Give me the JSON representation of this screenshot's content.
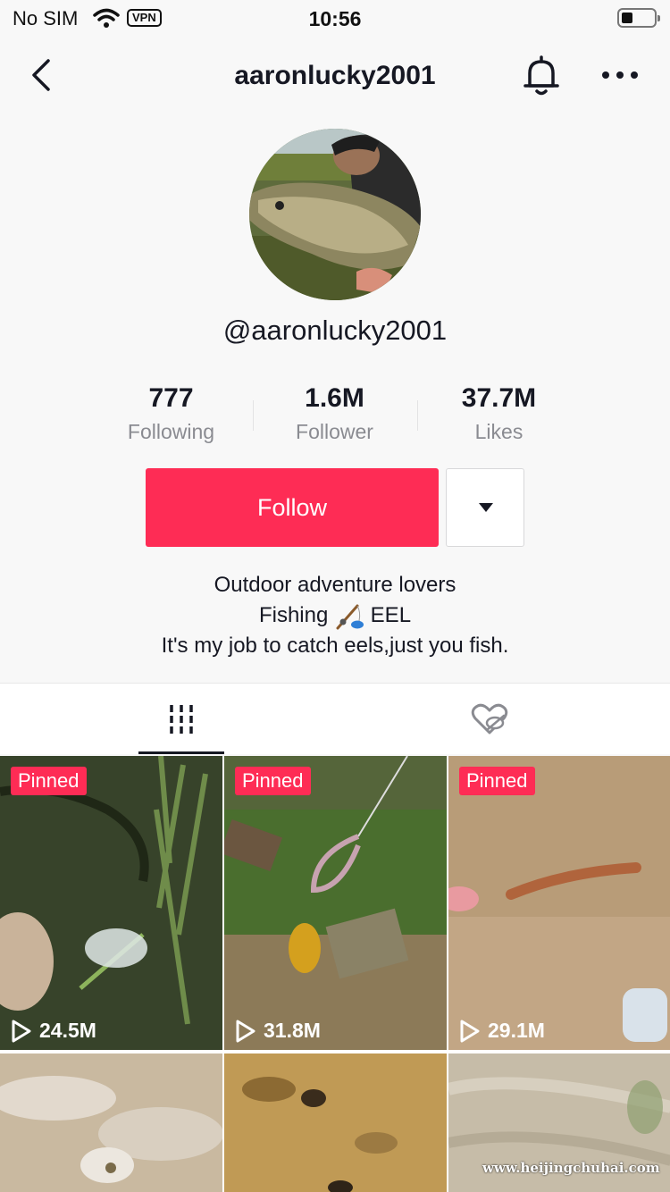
{
  "status_bar": {
    "carrier": "No SIM",
    "vpn": "VPN",
    "time": "10:56"
  },
  "nav": {
    "title": "aaronlucky2001",
    "back_icon": "chevron-left-icon",
    "bell_icon": "bell-icon",
    "more_icon": "more-dots-icon"
  },
  "profile": {
    "handle": "@aaronlucky2001",
    "stats": [
      {
        "value": "777",
        "label": "Following"
      },
      {
        "value": "1.6M",
        "label": "Follower"
      },
      {
        "value": "37.7M",
        "label": "Likes"
      }
    ],
    "follow_label": "Follow",
    "bio_line1": "Outdoor adventure lovers",
    "bio_line2_a": "Fishing",
    "bio_line2_b": "EEL",
    "bio_line3": "It's my job to catch eels,just you fish."
  },
  "tabs": [
    {
      "icon": "videos-grid-icon",
      "active": true
    },
    {
      "icon": "liked-hidden-icon",
      "active": false
    }
  ],
  "videos": [
    {
      "pinned": "Pinned",
      "views": "24.5M"
    },
    {
      "pinned": "Pinned",
      "views": "31.8M"
    },
    {
      "pinned": "Pinned",
      "views": "29.1M"
    },
    {
      "views": ""
    },
    {
      "views": ""
    },
    {
      "views": ""
    }
  ],
  "watermark": "www.heijingchuhai.com",
  "colors": {
    "accent": "#fe2c55",
    "text": "#161823",
    "muted": "#8a8b91"
  }
}
